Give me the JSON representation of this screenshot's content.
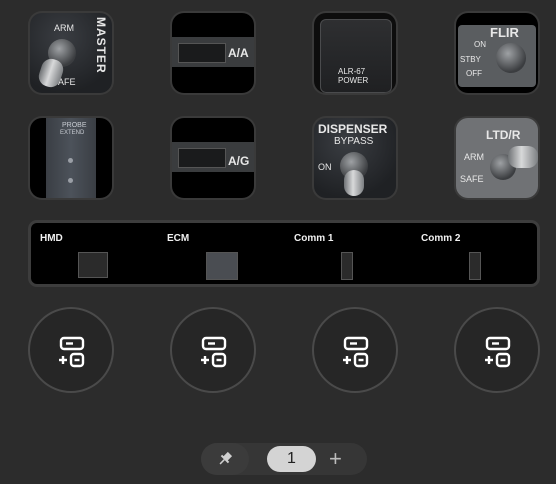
{
  "keys": [
    {
      "id": "master-arm",
      "labels": {
        "arm": "ARM",
        "master": "MASTER",
        "safe": "SAFE"
      }
    },
    {
      "id": "aa",
      "labels": {
        "mode": "A/A"
      }
    },
    {
      "id": "alr67",
      "labels": {
        "line1": "ALR-67",
        "line2": "POWER"
      }
    },
    {
      "id": "flir",
      "labels": {
        "title": "FLIR",
        "on": "ON",
        "stby": "STBY",
        "off": "OFF"
      }
    },
    {
      "id": "probe",
      "labels": {
        "probe": "PROBE",
        "extend": "EXTEND"
      }
    },
    {
      "id": "ag",
      "labels": {
        "mode": "A/G"
      }
    },
    {
      "id": "dispenser",
      "labels": {
        "title": "DISPENSER",
        "sub": "BYPASS",
        "on": "ON"
      }
    },
    {
      "id": "ltdr",
      "labels": {
        "title": "LTD/R",
        "arm": "ARM",
        "safe": "SAFE"
      }
    }
  ],
  "strip": {
    "items": [
      {
        "label": "HMD"
      },
      {
        "label": "ECM"
      },
      {
        "label": "Comm 1"
      },
      {
        "label": "Comm 2"
      }
    ]
  },
  "add_buttons": [
    {
      "icon": "add-slot-icon"
    },
    {
      "icon": "add-slot-icon"
    },
    {
      "icon": "add-slot-icon"
    },
    {
      "icon": "add-slot-icon"
    }
  ],
  "pager": {
    "current_page": "1",
    "pin_icon": "pin-icon",
    "add_icon": "plus-icon",
    "add_symbol": "+"
  }
}
